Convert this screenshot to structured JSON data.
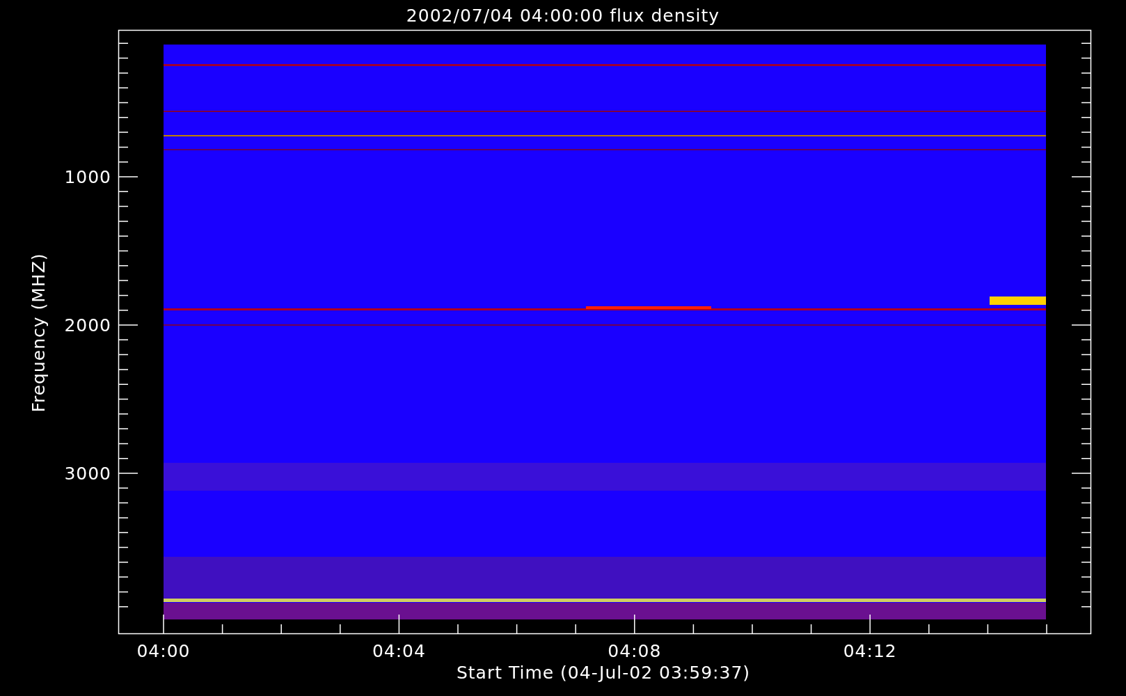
{
  "title": "2002/07/04 04:00:00 flux density",
  "y_axis": {
    "label": "Frequency (MHZ)",
    "tick_labels": [
      "1000",
      "2000",
      "3000"
    ]
  },
  "x_axis": {
    "label": "Start Time (04-Jul-02 03:59:37)",
    "tick_labels": [
      "04:00",
      "04:04",
      "04:08",
      "04:12"
    ]
  }
}
